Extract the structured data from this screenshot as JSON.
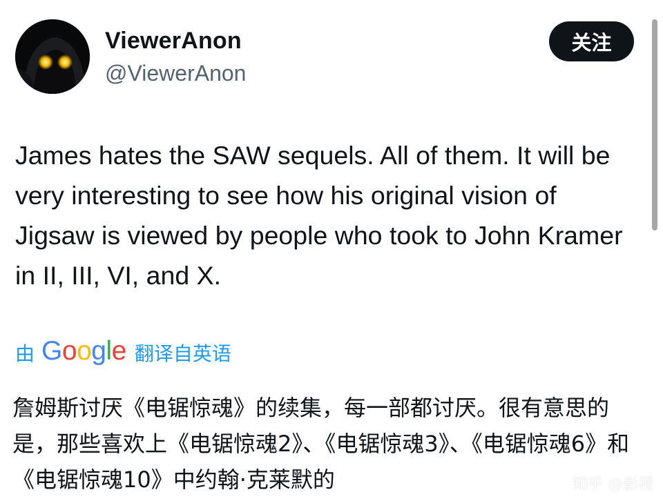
{
  "header": {
    "display_name": "ViewerAnon",
    "handle": "@ViewerAnon",
    "follow_label": "关注"
  },
  "tweet": {
    "text": "James hates the SAW sequels. All of them. It will be very interesting to see how his original vision of Jigsaw is viewed by people who took to John Kramer in II, III, VI, and X."
  },
  "translation": {
    "by_label": "由",
    "provider_logo": {
      "letters": [
        "G",
        "o",
        "o",
        "g",
        "l",
        "e"
      ],
      "colors": [
        "#4285F4",
        "#EA4335",
        "#FBBC05",
        "#4285F4",
        "#34A853",
        "#EA4335"
      ]
    },
    "from_label": "翻译自英语",
    "text": "詹姆斯讨厌《电锯惊魂》的续集，每一部都讨厌。很有意思的是，那些喜欢上《电锯惊魂2》、《电锯惊魂3》、《电锯惊魂6》和《电锯惊魂10》中约翰·克莱默的"
  },
  "watermark": {
    "text": "知乎 @影视"
  },
  "icons": {
    "avatar": "dark-hooded-figure-glowing-eyes-avatar"
  },
  "colors": {
    "link": "#1d9bf0",
    "button_bg": "#0f1419",
    "handle": "#536471"
  }
}
